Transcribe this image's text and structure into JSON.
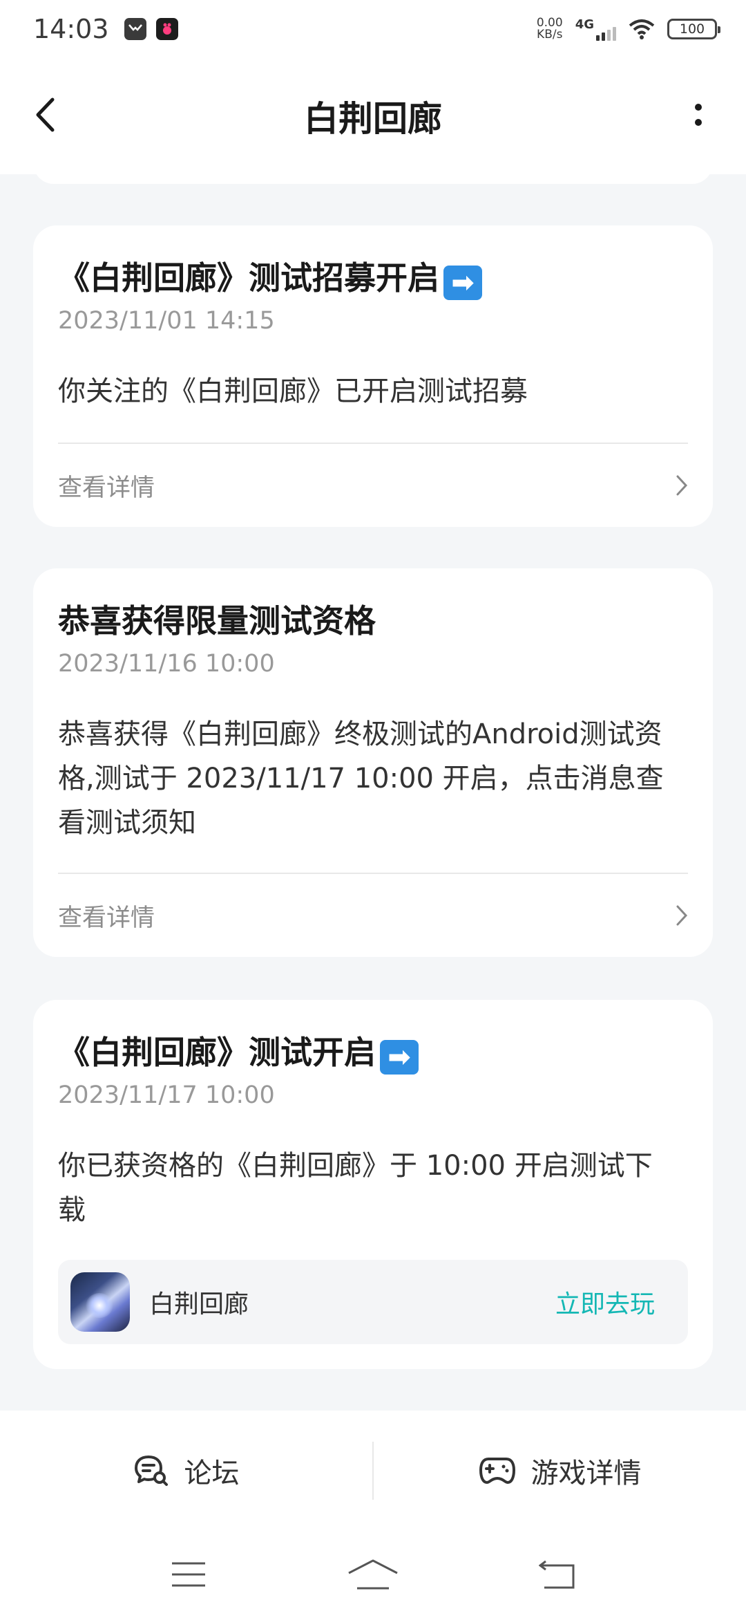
{
  "status_bar": {
    "time": "14:03",
    "net_speed": "0.00",
    "net_unit": "KB/s",
    "network": "4G",
    "battery": "100"
  },
  "header": {
    "title": "白荆回廊",
    "back_icon": "chevron-left-icon",
    "more_icon": "more-vertical-icon"
  },
  "messages": [
    {
      "title": "《白荆回廊》测试招募开启",
      "title_emoji": "➡",
      "date": "2023/11/01 14:15",
      "body": "你关注的《白荆回廊》已开启测试招募",
      "link": "查看详情"
    },
    {
      "title": "恭喜获得限量测试资格",
      "date": "2023/11/16 10:00",
      "body_lines": [
        "恭喜获得《白荆回廊》终极测试的Android测试资",
        "格,测试于 2023/11/17 10:00 开启，点击消息查",
        "看测试须知"
      ],
      "link": "查看详情"
    },
    {
      "title": "《白荆回廊》测试开启",
      "title_emoji": "➡",
      "date": "2023/11/17 10:00",
      "body_lines": [
        "你已获资格的《白荆回廊》于 10:00 开启测试下",
        "载"
      ],
      "game_name": "白荆回廊",
      "game_action": "立即去玩"
    }
  ],
  "bottom_tabs": {
    "forum": "论坛",
    "game_detail": "游戏详情"
  },
  "colors": {
    "accent": "#14b7b4",
    "background": "#f4f6f8",
    "card": "#ffffff",
    "date_text": "#999999"
  }
}
